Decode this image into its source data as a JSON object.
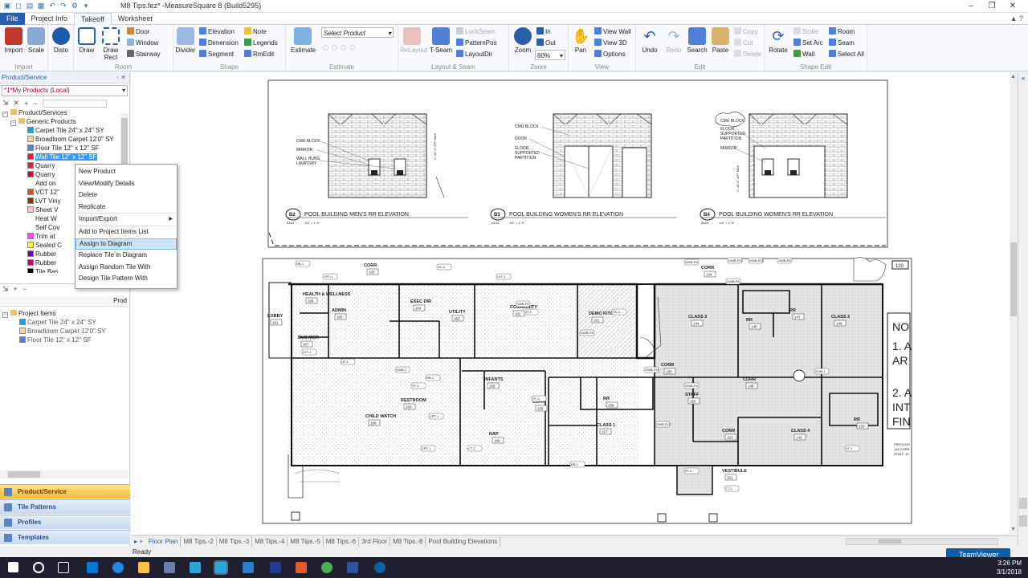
{
  "app": {
    "title": "M8 Tips.fez* -MeasureSquare 8 (Build5295)",
    "status": "Ready",
    "teamviewer": "TeamViewer"
  },
  "menu_tabs": [
    "File",
    "Project Info",
    "Takeoff",
    "Worksheet"
  ],
  "ribbon": {
    "import": {
      "label": "Import",
      "group": "Import"
    },
    "scale": {
      "label": "Scale"
    },
    "disto": {
      "label": "Disto"
    },
    "draw": {
      "label": "Draw"
    },
    "draw_rect": {
      "label": "Draw Rect"
    },
    "room_small": [
      "Door",
      "Window",
      "Stairway"
    ],
    "room_group": "Room",
    "divider": {
      "label": "Divider"
    },
    "shape_small": [
      "Elevation",
      "Dimension",
      "Segment",
      "Note",
      "Legends",
      "RmEdit"
    ],
    "shape_group": "Shape",
    "estimate": {
      "label": "Estimate",
      "group": "Estimate"
    },
    "select_product": "Select Product",
    "relayout": "ReLayout",
    "tseam": "T-Seam",
    "layout_small": [
      "LockSeam",
      "PatternPos",
      "LayoutDir"
    ],
    "layout_group": "Layout & Seam",
    "zoom": {
      "label": "Zoom",
      "in": "In",
      "out": "Out",
      "value": "60%",
      "group": "Zoom"
    },
    "pan": "Pan",
    "view_small": [
      "View Wall",
      "View 3D",
      "Options"
    ],
    "view_group": "View",
    "undo": "Undo",
    "redo": "Redo",
    "search": "Search",
    "paste": "Paste",
    "edit_small": [
      "Copy",
      "Cut",
      "Delete"
    ],
    "edit_group": "Edit",
    "rotate": "Rotate",
    "shape_edit_small": [
      "Scale",
      "Set Arc",
      "Wall",
      "Room",
      "Seam",
      "Select All"
    ],
    "shape_edit_group": "Shape Edit"
  },
  "left_panel": {
    "header": "Product/Service",
    "combo": "*1*My Products (Local)",
    "tree_root": "Product/Services",
    "tree_group": "Generic Products",
    "products": [
      {
        "label": "Carpet Tile 24\" x 24\" SY",
        "color": "#00a8e8"
      },
      {
        "label": "Broadloom Carpet 12'0\" SY",
        "color": "#f2d9a0"
      },
      {
        "label": "Floor Tile 12\" x 12\" SF",
        "color": "#4f7fd6"
      },
      {
        "label": "Wall Tile 12\" x 12\" SF",
        "color": "#e0203c"
      },
      {
        "label": "Quarry",
        "color": "#e0203c"
      },
      {
        "label": "Quarry",
        "color": "#c0102c"
      },
      {
        "label": "Add on",
        "color": "#ffffff"
      },
      {
        "label": "VCT 12\"",
        "color": "#d9531e"
      },
      {
        "label": "LVT Viny",
        "color": "#7a3a10"
      },
      {
        "label": "Sheet V",
        "color": "#f4c0c0"
      },
      {
        "label": "Heat W",
        "color": "#ffffff"
      },
      {
        "label": "Self Cov",
        "color": "#ffffff"
      },
      {
        "label": "Trim at",
        "color": "#ff40ff"
      },
      {
        "label": "Sealed C",
        "color": "#ffff00"
      },
      {
        "label": "Rubber",
        "color": "#7000c0"
      },
      {
        "label": "Rubber",
        "color": "#d00060"
      },
      {
        "label": "Tile Bas",
        "color": "#000000"
      }
    ],
    "lower_col": "Prod",
    "project_root": "Project Items",
    "project_items": [
      {
        "label": "Carpet Tile 24\" x 24\" SY",
        "color": "#00a8e8"
      },
      {
        "label": "Broadloom Carpet 12'0\" SY",
        "color": "#f2d9a0"
      },
      {
        "label": "Floor Tile 12\" x 12\" SF",
        "color": "#4f7fd6"
      }
    ],
    "nav": [
      "Product/Service",
      "Tile Patterns",
      "Profiles",
      "Templates"
    ]
  },
  "context_menu": {
    "items": [
      "New Product",
      "View/Modify Details",
      "Delete",
      "Replicate",
      "Import/Export",
      "Add to Project Items List",
      "Assign to Diagram",
      "Replace Tile in Diagram",
      "Assign Random Tile With",
      "Design Tile Pattern With"
    ],
    "selected": "Assign to Diagram"
  },
  "drawing": {
    "elevations": [
      {
        "num": "B2",
        "sheet": "A103",
        "title": "POOL BUILDING MEN'S RR ELEVATION",
        "scale": "1/4\" = 1'-0\"",
        "notes": [
          "CMU BLOCK",
          "MIRROR",
          "WALL HUNG",
          "LAVATORY"
        ],
        "height": "+/- 10'-0\" AFF MAX"
      },
      {
        "num": "B3",
        "sheet": "A103",
        "title": "POOL BUILDING WOMEN'S RR ELEVATION",
        "scale": "1/4\" = 1'-0\"",
        "notes": [
          "CMU BLOCK",
          "DOOR",
          "FLOOR",
          "SUPPORTED",
          "PARTITION"
        ],
        "height": ""
      },
      {
        "num": "B4",
        "sheet": "A103",
        "title": "POOL BUILDING WOMEN'S RR ELEVATION",
        "scale": "1/4\" = 1'-0\"",
        "notes": [
          "CMU BLOCK",
          "FLOOR",
          "SUPPORTED",
          "PARTITION",
          "MIRROR"
        ],
        "height": "+/- 10'-0\" AFF MAX"
      }
    ],
    "rooms": [
      {
        "name": "HEALTH & WELLNESS",
        "num": "166"
      },
      {
        "name": "ADMIN",
        "num": "165"
      },
      {
        "name": "EXEC DIR",
        "num": "164"
      },
      {
        "name": "UTILITY",
        "num": "163"
      },
      {
        "name": "COMMUNITY",
        "num": "162"
      },
      {
        "name": "DEMO KITCHEN",
        "num": "161"
      },
      {
        "name": "CLASS 3",
        "num": "144"
      },
      {
        "name": "RR",
        "num": "145"
      },
      {
        "name": "RR",
        "num": "147"
      },
      {
        "name": "CLASS 2",
        "num": "146"
      },
      {
        "name": "LOBBY",
        "num": "101"
      },
      {
        "name": "BUS MGR",
        "num": "167"
      },
      {
        "name": "CORR",
        "num": "103"
      },
      {
        "name": "CORR",
        "num": "134"
      },
      {
        "name": "CORR",
        "num": "150"
      },
      {
        "name": "CORR",
        "num": "148"
      },
      {
        "name": "CHILD WATCH",
        "num": "168"
      },
      {
        "name": "RESTROOM",
        "num": "169"
      },
      {
        "name": "INFANTS",
        "num": "159"
      },
      {
        "name": "CORR",
        "num": "155"
      },
      {
        "name": "RR",
        "num": "158"
      },
      {
        "name": "CLASS 1",
        "num": "157"
      },
      {
        "name": "STAFF",
        "num": "156"
      },
      {
        "name": "NAP",
        "num": "160"
      },
      {
        "name": "CORR",
        "num": "153"
      },
      {
        "name": "CLASS 4",
        "num": "149"
      },
      {
        "name": "RR",
        "num": "150"
      },
      {
        "name": "VESTIBULE",
        "num": "151"
      }
    ],
    "tags": [
      "RB-1",
      "CPT-1",
      "LVT-1",
      "QT-1",
      "SC-2",
      "GWB-P5",
      "GWB-P6",
      "GWB-P11",
      "GWB-P12",
      "GWB-P# ",
      "SOM-1",
      "ST-1",
      "CT-2",
      "PT-3"
    ],
    "side_note": [
      "NO",
      "1. A",
      "AR",
      "2. A",
      "INT",
      "FIN"
    ],
    "side_small": [
      "PRESCHO",
      "148 CORR",
      "STAFF, 16"
    ],
    "side_box": "120"
  },
  "sheet_tabs": [
    "Floor Plan",
    "M8 Tips.-2",
    "M8 Tips.-3",
    "M8 Tips.-4",
    "M8 Tips.-5",
    "M8 Tips.-6",
    "3rd Floor",
    "M8 Tips.-8",
    "Pool Building Elevations"
  ],
  "active_sheet": "Floor Plan",
  "clock": {
    "time": "3:26 PM",
    "date": "3/1/2018"
  },
  "colors": {
    "accent": "#2b5fa9",
    "selection": "#3399ff",
    "nav_active": "#f6b73c"
  }
}
